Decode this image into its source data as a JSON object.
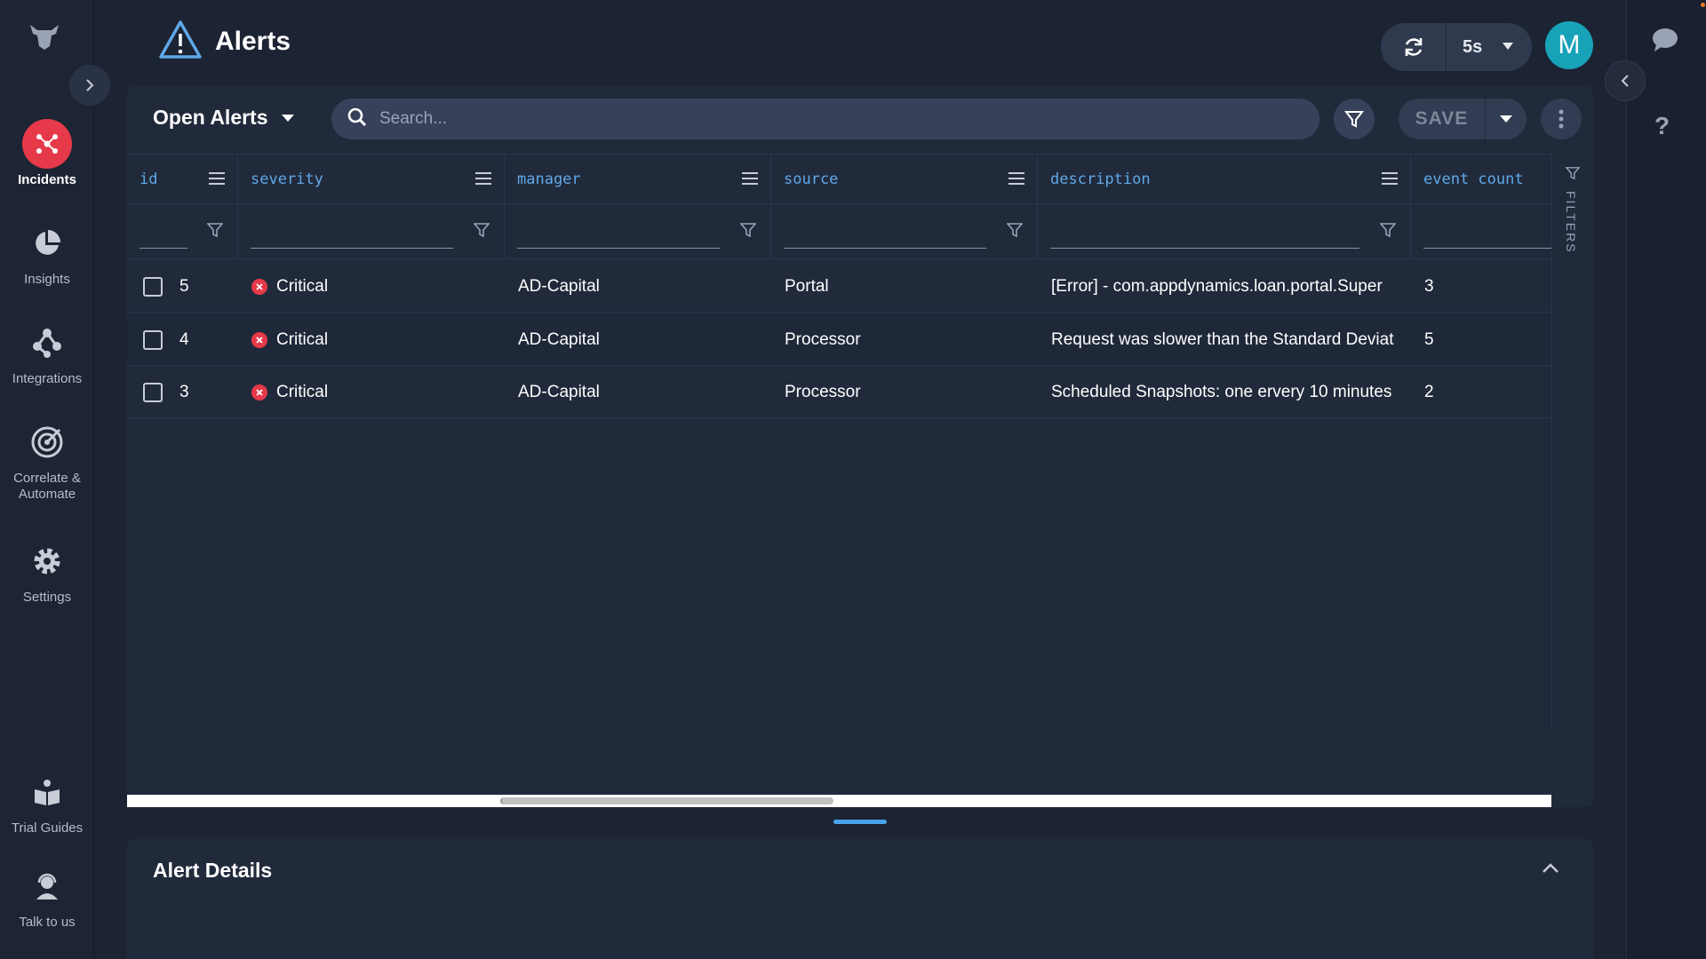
{
  "nav": {
    "items": [
      {
        "label": "Incidents",
        "icon": "incidents-icon",
        "active": true
      },
      {
        "label": "Insights",
        "icon": "pie-chart-icon"
      },
      {
        "label": "Integrations",
        "icon": "integrations-icon"
      },
      {
        "label": "Correlate & Automate",
        "icon": "target-icon"
      },
      {
        "label": "Settings",
        "icon": "gear-icon"
      },
      {
        "label": "Trial Guides",
        "icon": "book-icon"
      },
      {
        "label": "Talk to us",
        "icon": "support-agent-icon"
      }
    ]
  },
  "header": {
    "title": "Alerts",
    "refresh_interval": "5s",
    "avatar_initial": "M"
  },
  "toolbar": {
    "view_label": "Open Alerts",
    "search_placeholder": "Search...",
    "save_label": "SAVE"
  },
  "table": {
    "columns": [
      {
        "key": "id",
        "label": "id"
      },
      {
        "key": "severity",
        "label": "severity"
      },
      {
        "key": "manager",
        "label": "manager"
      },
      {
        "key": "source",
        "label": "source"
      },
      {
        "key": "description",
        "label": "description"
      },
      {
        "key": "event_count",
        "label": "event count"
      }
    ],
    "rows": [
      {
        "id": "5",
        "severity": "Critical",
        "manager": "AD-Capital",
        "source": "Portal",
        "description": "[Error] - com.appdynamics.loan.portal.Super",
        "event_count": "3"
      },
      {
        "id": "4",
        "severity": "Critical",
        "manager": "AD-Capital",
        "source": "Processor",
        "description": "Request was slower than the Standard Deviat",
        "event_count": "5"
      },
      {
        "id": "3",
        "severity": "Critical",
        "manager": "AD-Capital",
        "source": "Processor",
        "description": "Scheduled Snapshots: one ervery 10 minutes",
        "event_count": "2"
      }
    ],
    "filters_label": "FILTERS"
  },
  "details": {
    "title": "Alert Details"
  },
  "colors": {
    "accent": "#5fa8e8",
    "critical": "#e6394a",
    "avatar": "#17a2b8"
  }
}
